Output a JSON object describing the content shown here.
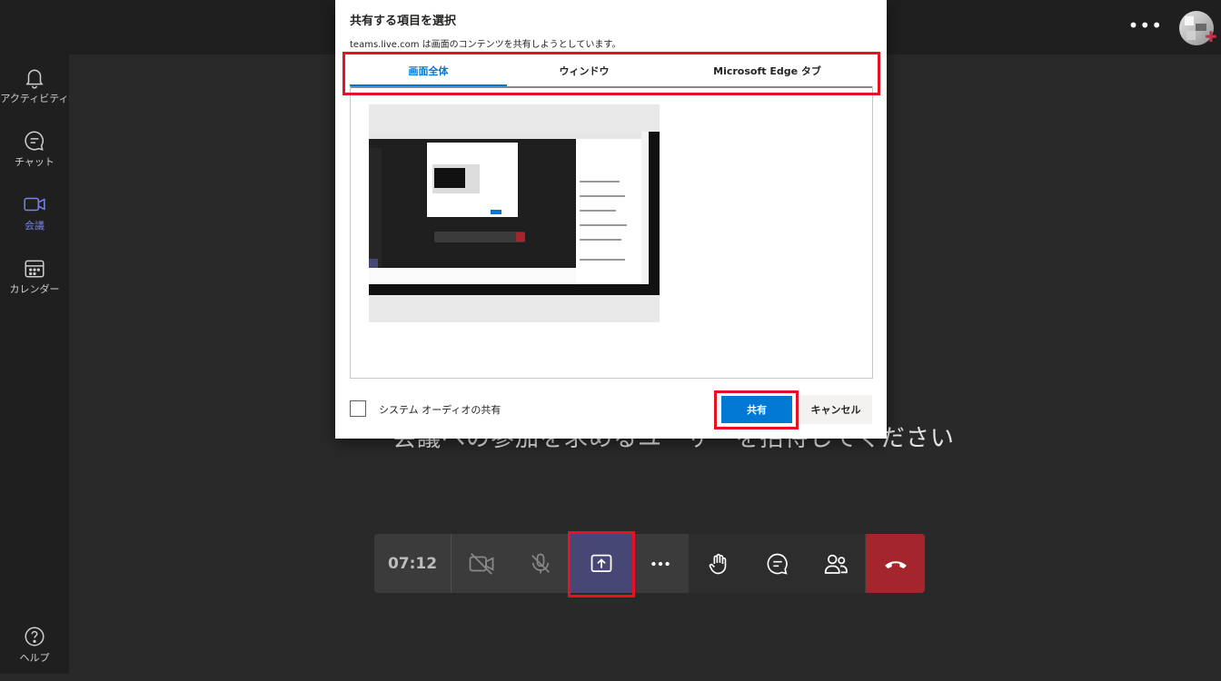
{
  "topbar": {
    "more_label": "•••"
  },
  "rail": {
    "items": [
      {
        "label": "アクティビティ",
        "icon": "bell-icon"
      },
      {
        "label": "チャット",
        "icon": "chat-icon"
      },
      {
        "label": "会議",
        "icon": "video-camera-icon"
      },
      {
        "label": "カレンダー",
        "icon": "calendar-icon"
      }
    ],
    "help_label": "ヘルプ"
  },
  "stage": {
    "invite_text": "会議への参加を求めるユーザーを招待してください"
  },
  "controls": {
    "timer": "07:12",
    "hangup_color": "#a4262c"
  },
  "dialog": {
    "title": "共有する項目を選択",
    "description": "teams.live.com は画面のコンテンツを共有しようとしています。",
    "tabs": [
      {
        "label": "画面全体",
        "active": true
      },
      {
        "label": "ウィンドウ",
        "active": false
      },
      {
        "label": "Microsoft Edge タブ",
        "active": false
      }
    ],
    "audio_label": "システム オーディオの共有",
    "share_label": "共有",
    "cancel_label": "キャンセル",
    "accent_color": "#0078d4",
    "highlight_color": "#e81123"
  }
}
